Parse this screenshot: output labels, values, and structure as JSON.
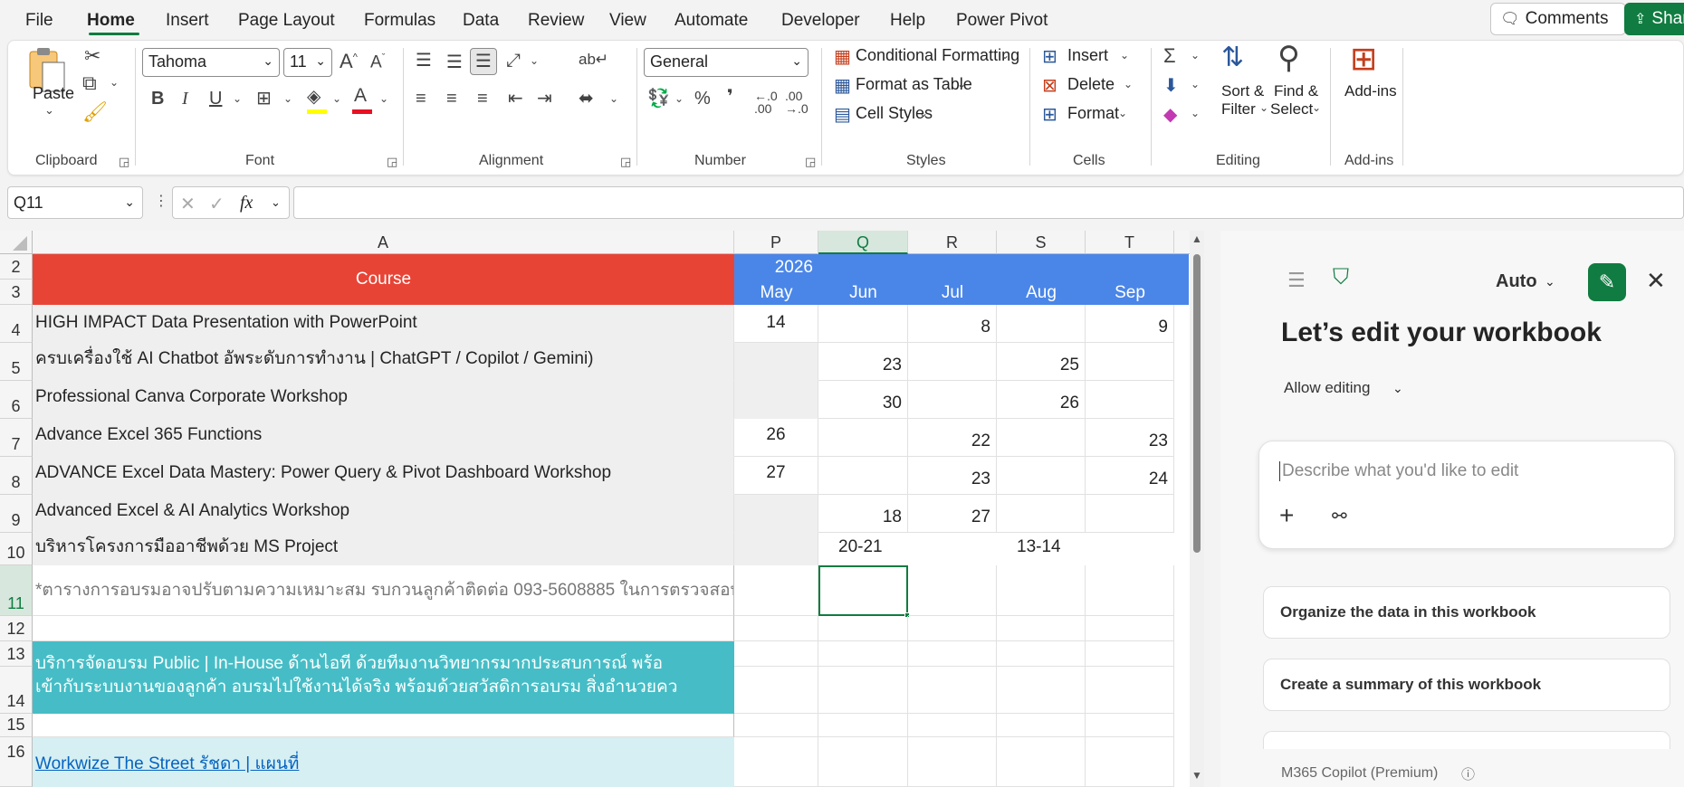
{
  "menu": {
    "items": [
      "File",
      "Home",
      "Insert",
      "Page Layout",
      "Formulas",
      "Data",
      "Review",
      "View",
      "Automate",
      "Developer",
      "Help",
      "Power Pivot"
    ],
    "active": "Home",
    "comments_label": "Comments",
    "share_label": "Shar"
  },
  "ribbon": {
    "clipboard": {
      "paste_label": "Paste",
      "group_label": "Clipboard"
    },
    "font": {
      "font_name": "Tahoma",
      "font_size": "11",
      "group_label": "Font",
      "bold": "B",
      "italic": "I",
      "underline": "U",
      "font_color": "#e81123",
      "highlight_color": "#ffff00"
    },
    "alignment": {
      "group_label": "Alignment"
    },
    "number": {
      "format": "General",
      "group_label": "Number"
    },
    "styles": {
      "conditional": "Conditional Formatting",
      "format_table": "Format as Table",
      "cell_styles": "Cell Styles",
      "group_label": "Styles"
    },
    "cells": {
      "insert": "Insert",
      "delete": "Delete",
      "format": "Format",
      "group_label": "Cells"
    },
    "editing": {
      "sort_line1": "Sort &",
      "sort_line2": "Filter",
      "find_line1": "Find &",
      "find_line2": "Select",
      "group_label": "Editing"
    },
    "addins": {
      "label": "Add-ins",
      "group_label": "Add-ins"
    }
  },
  "formula_bar": {
    "name_box": "Q11",
    "fx": "fx",
    "formula": ""
  },
  "sheet": {
    "columns": [
      "A",
      "P",
      "Q",
      "R",
      "S",
      "T"
    ],
    "selected_column": "Q",
    "selected_row": "11",
    "header_row": {
      "course": "Course",
      "year": "2026",
      "months": [
        "May",
        "Jun",
        "Jul",
        "Aug",
        "Sep"
      ]
    },
    "rows": [
      {
        "num": "4",
        "course": "HIGH IMPACT Data Presentation with PowerPoint",
        "p": "14",
        "q": "",
        "r": "8",
        "s": "",
        "t": "9"
      },
      {
        "num": "5",
        "course": "ครบเครื่องใช้  AI Chatbot อัพระดับการทำงาน | ChatGPT / Copilot / Gemini)",
        "p": "",
        "q": "23",
        "r": "",
        "s": "25",
        "t": ""
      },
      {
        "num": "6",
        "course": "Professional Canva Corporate Workshop",
        "p": "",
        "q": "30",
        "r": "",
        "s": "26",
        "t": ""
      },
      {
        "num": "7",
        "course": "Advance Excel 365 Functions",
        "p": "26",
        "q": "",
        "r": "22",
        "s": "",
        "t": "23"
      },
      {
        "num": "8",
        "course": "ADVANCE Excel Data Mastery:  Power Query & Pivot Dashboard Workshop",
        "p": "27",
        "q": "",
        "r": "23",
        "s": "",
        "t": "24"
      },
      {
        "num": "9",
        "course": "Advanced Excel & AI Analytics Workshop",
        "p": "",
        "q": "18",
        "r": "27",
        "s": "",
        "t": ""
      },
      {
        "num": "10",
        "course": "บริหารโครงการมืออาชีพด้วย MS Project",
        "p": "",
        "q": "20-21",
        "r": "",
        "s": "13-14",
        "t": ""
      }
    ],
    "note_row": "*ตารางการอบรมอาจปรับตามความเหมาะสม รบกวนลูกค้าติดต่อ 093-5608885 ในการตรวจสอบ",
    "promo_line1": "บริการจัดอบรม Public | In-House ด้านไอที ด้วยทีมงานวิทยากรมากประสบการณ์ พร้อ",
    "promo_line2": "เข้ากับระบบงานของลูกค้า อบรมไปใช้งานได้จริง พร้อมด้วยสวัสดิการอบรม สิ่งอำนวยคว",
    "link_text": "Workwize The Street รัชดา | แผนที่",
    "row_numbers": [
      "2",
      "3",
      "4",
      "5",
      "6",
      "7",
      "8",
      "9",
      "10",
      "11",
      "12",
      "13",
      "14",
      "15",
      "16"
    ],
    "colors": {
      "course_header": "#e84436",
      "month_header": "#4a86e8",
      "promo": "#46bdc6",
      "link_bg": "#d6eff2",
      "row_gray": "#efefef"
    }
  },
  "copilot": {
    "mode": "Auto",
    "title": "Let’s edit your workbook",
    "allow_editing": "Allow editing",
    "placeholder": "Describe what you'd like to edit",
    "suggestions": [
      "Organize the data in this workbook",
      "Create a summary of this workbook"
    ],
    "footer": "M365 Copilot (Premium)"
  }
}
